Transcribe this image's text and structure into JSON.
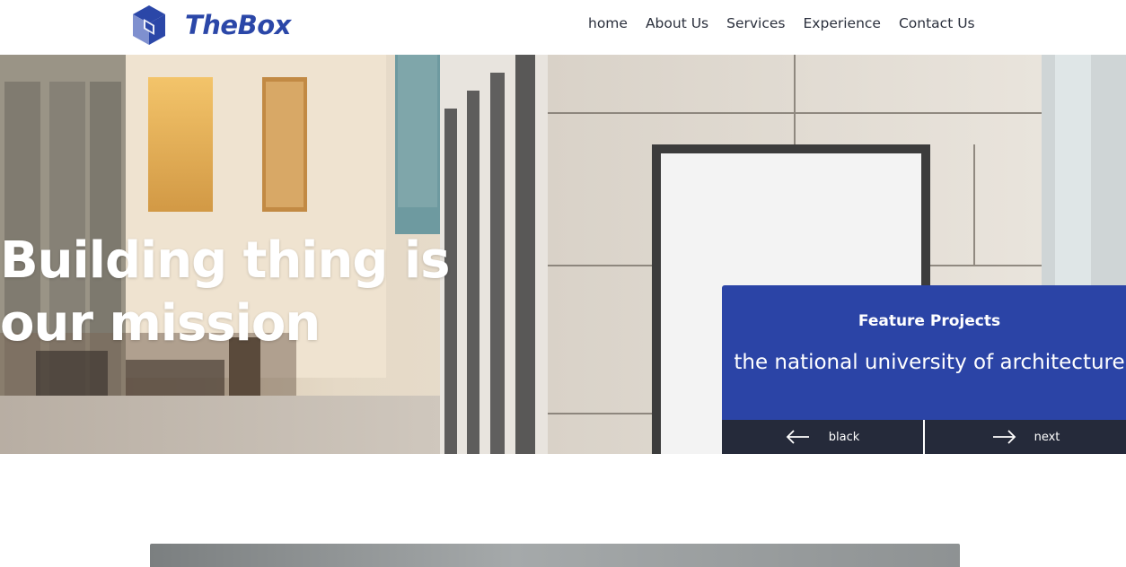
{
  "brand": {
    "name": "TheBox",
    "color": "#2b47a8"
  },
  "nav": [
    {
      "label": "home"
    },
    {
      "label": "About Us"
    },
    {
      "label": "Services"
    },
    {
      "label": "Experience"
    },
    {
      "label": "Contact Us"
    }
  ],
  "hero": {
    "title": "Building thing is our mission"
  },
  "feature": {
    "heading": "Feature Projects",
    "project": "the national university of architecture",
    "prev_label": "black",
    "next_label": "next",
    "card_color": "#2b44a6",
    "bar_color": "#252a3a"
  },
  "icons": {
    "prev": "arrow-left-icon",
    "next": "arrow-right-icon",
    "logo": "cube-logo-icon"
  }
}
